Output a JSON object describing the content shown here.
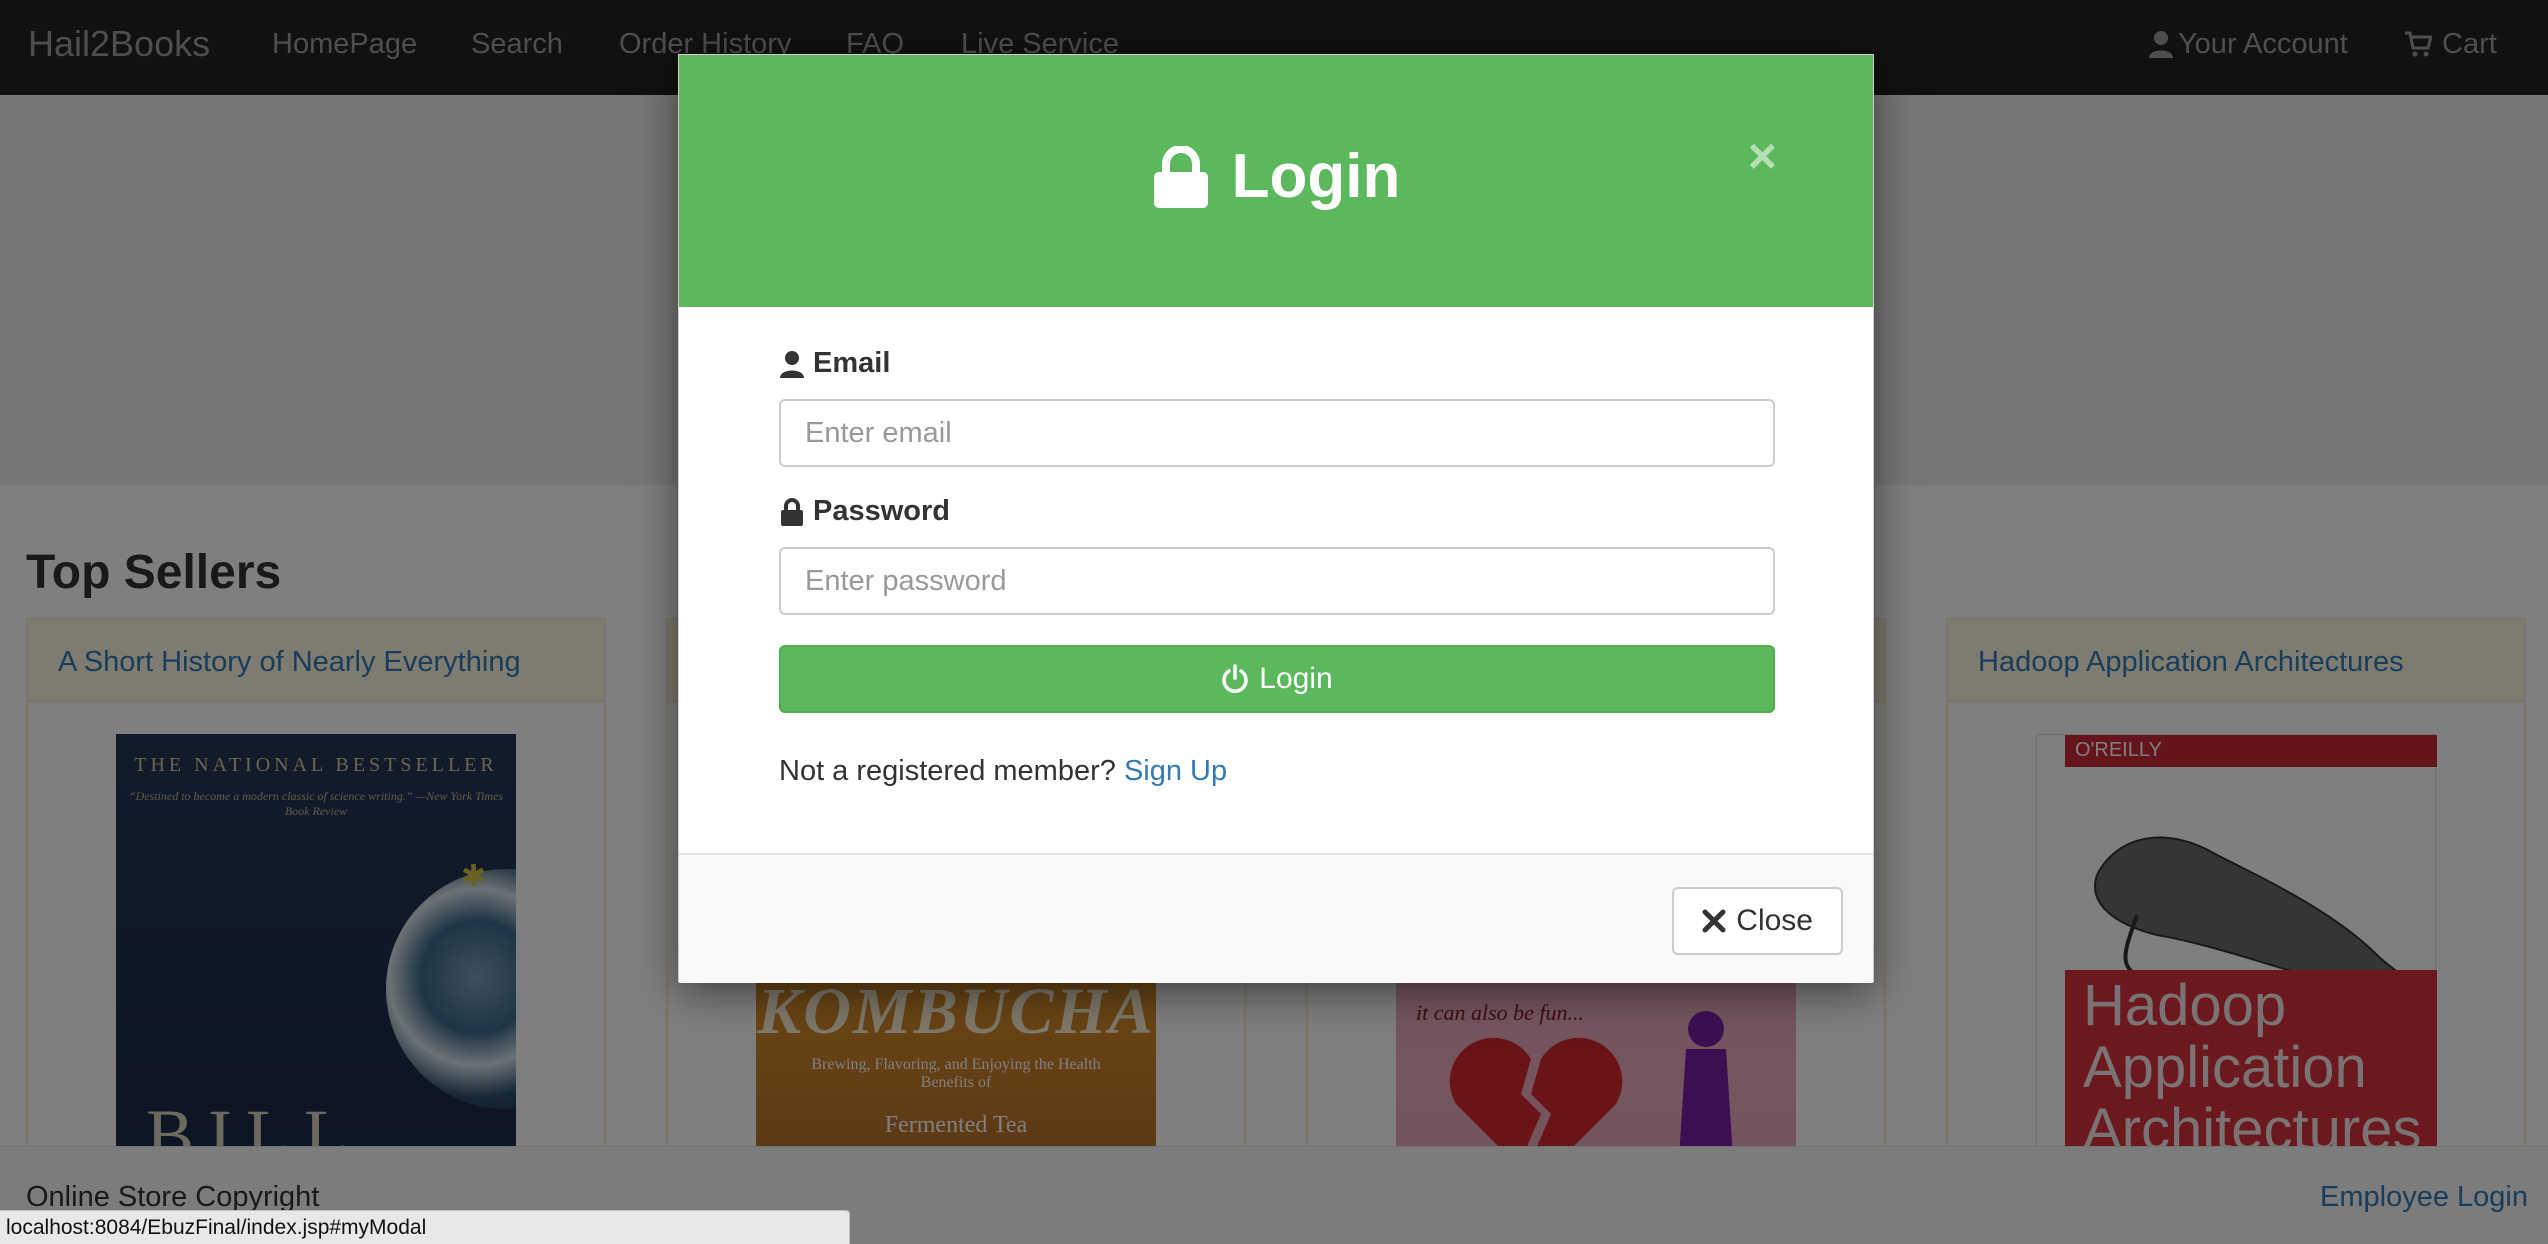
{
  "navbar": {
    "brand": "Hail2Books",
    "links": [
      "HomePage",
      "Search",
      "Order History",
      "FAQ",
      "Live Service"
    ],
    "account": "Your Account",
    "cart": "Cart"
  },
  "main": {
    "section_title": "Top Sellers",
    "books": [
      {
        "title": "A Short History of Nearly Everything",
        "cover_top": "THE NATIONAL BESTSELLER",
        "cover_quote": "“Destined to become a modern classic of science writing.” —New York Times Book Review",
        "cover_author": "BILL"
      },
      {
        "title": "",
        "cover_title": "KOMBUCHA",
        "cover_sub": "Brewing, Flavoring, and Enjoying the Health Benefits of",
        "cover_sub2": "Fermented Tea"
      },
      {
        "title": "",
        "cover_text": "it can also be fun..."
      },
      {
        "title": "Hadoop Application Architectures",
        "publisher": "O'REILLY",
        "cover_title": "Hadoop Application Architectures"
      }
    ]
  },
  "footer": {
    "copyright": "Online Store Copyright",
    "employee_login": "Employee Login"
  },
  "statusbar": {
    "url": "localhost:8084/EbuzFinal/index.jsp#myModal"
  },
  "modal": {
    "title": "Login",
    "close_x": "×",
    "email_label": "Email",
    "email_placeholder": "Enter email",
    "password_label": "Password",
    "password_placeholder": "Enter password",
    "login_button": "Login",
    "register_text": "Not a registered member?",
    "signup_link": "Sign Up",
    "close_button": "Close"
  },
  "colors": {
    "accent_green": "#5cb85c",
    "link_blue": "#337ab7",
    "navbar_bg": "#222222"
  }
}
